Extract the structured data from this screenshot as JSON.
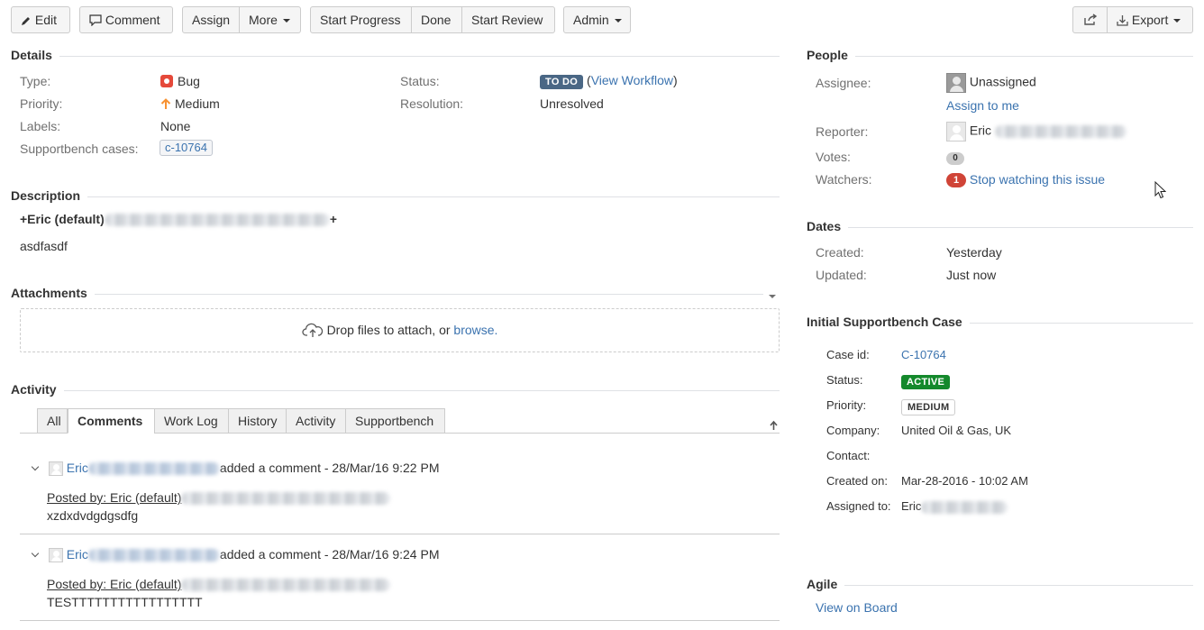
{
  "toolbar": {
    "edit": "Edit",
    "comment": "Comment",
    "assign": "Assign",
    "more": "More",
    "start_progress": "Start Progress",
    "done": "Done",
    "start_review": "Start Review",
    "admin": "Admin",
    "export": "Export"
  },
  "details": {
    "title": "Details",
    "type_label": "Type:",
    "type_value": "Bug",
    "priority_label": "Priority:",
    "priority_value": "Medium",
    "labels_label": "Labels:",
    "labels_value": "None",
    "cases_label": "Supportbench cases:",
    "cases_value": "c-10764",
    "status_label": "Status:",
    "status_value": "TO DO",
    "view_workflow": "View Workflow",
    "resolution_label": "Resolution:",
    "resolution_value": "Unresolved"
  },
  "description": {
    "title": "Description",
    "line1_prefix": "+Eric (default)",
    "line1_suffix": "+",
    "body": "asdfasdf"
  },
  "attachments": {
    "title": "Attachments",
    "drop_text": "Drop files to attach, or",
    "browse": "browse."
  },
  "activity": {
    "title": "Activity",
    "tabs": [
      "All",
      "Comments",
      "Work Log",
      "History",
      "Activity",
      "Supportbench"
    ],
    "selected_tab": "Comments",
    "comments": [
      {
        "author": "Eric",
        "action": "added a comment - 28/Mar/16 9:22 PM",
        "posted_by": "Posted by: Eric (default)",
        "body": "xzdxdvdgdgsdfg"
      },
      {
        "author": "Eric",
        "action": "added a comment - 28/Mar/16 9:24 PM",
        "posted_by": "Posted by: Eric (default)",
        "body": "TESTTTTTTTTTTTTTTTTT"
      }
    ]
  },
  "people": {
    "title": "People",
    "assignee_label": "Assignee:",
    "assignee_value": "Unassigned",
    "assign_to_me": "Assign to me",
    "reporter_label": "Reporter:",
    "reporter_value": "Eric",
    "votes_label": "Votes:",
    "votes_count": "0",
    "watchers_label": "Watchers:",
    "watchers_count": "1",
    "stop_watching": "Stop watching this issue"
  },
  "dates": {
    "title": "Dates",
    "created_label": "Created:",
    "created_value": "Yesterday",
    "updated_label": "Updated:",
    "updated_value": "Just now"
  },
  "supportbench": {
    "title": "Initial Supportbench Case",
    "case_id_label": "Case id:",
    "case_id_value": "C-10764",
    "status_label": "Status:",
    "status_value": "ACTIVE",
    "priority_label": "Priority:",
    "priority_value": "MEDIUM",
    "company_label": "Company:",
    "company_value": "United Oil & Gas, UK",
    "contact_label": "Contact:",
    "contact_value": "",
    "created_on_label": "Created on:",
    "created_on_value": "Mar-28-2016 - 10:02 AM",
    "assigned_to_label": "Assigned to:",
    "assigned_to_value": "Eric"
  },
  "agile": {
    "title": "Agile",
    "view_on_board": "View on Board"
  },
  "colors": {
    "link": "#3b73af",
    "todo_lozenge": "#4a6785",
    "active_lozenge": "#14892c",
    "bug_icon": "#e5493a",
    "priority_arrow": "#f79232",
    "watch_badge": "#d04437"
  }
}
